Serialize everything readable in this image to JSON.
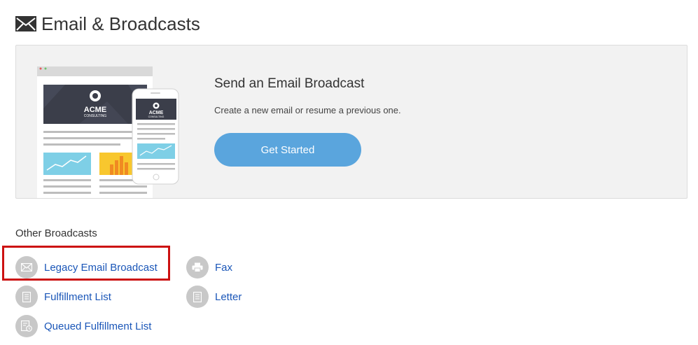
{
  "header": {
    "icon": "envelope-icon",
    "title": "Email & Broadcasts"
  },
  "hero": {
    "title": "Send an Email Broadcast",
    "subtitle": "Create a new email or resume a previous one.",
    "cta_label": "Get Started",
    "illustration": {
      "brand_name": "ACME",
      "brand_tagline": "CONSULTING"
    }
  },
  "other_broadcasts": {
    "title": "Other Broadcasts",
    "items": [
      {
        "label": "Legacy Email Broadcast",
        "icon": "envelope-icon"
      },
      {
        "label": "Fax",
        "icon": "printer-icon"
      },
      {
        "label": "Fulfillment List",
        "icon": "document-icon"
      },
      {
        "label": "Letter",
        "icon": "document-icon"
      },
      {
        "label": "Queued Fulfillment List",
        "icon": "document-clock-icon"
      }
    ]
  },
  "colors": {
    "accent_button": "#5aa5dd",
    "link": "#1a56b8",
    "highlight_border": "#cc1111",
    "icon_circle": "#c8c8c8"
  }
}
